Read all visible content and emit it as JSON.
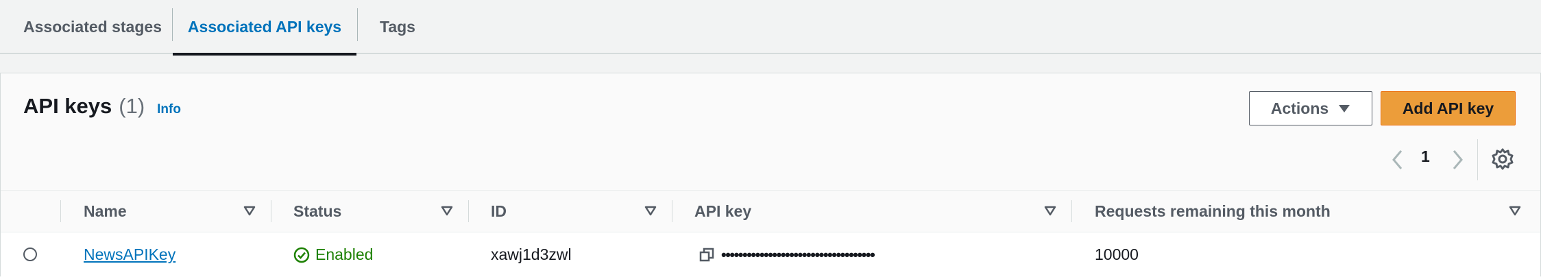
{
  "tabs": [
    {
      "label": "Associated stages",
      "active": false
    },
    {
      "label": "Associated API keys",
      "active": true
    },
    {
      "label": "Tags",
      "active": false
    }
  ],
  "panel": {
    "title": "API keys",
    "count": "(1)",
    "info_label": "Info",
    "actions_label": "Actions",
    "add_label": "Add API key"
  },
  "pagination": {
    "current_page": "1"
  },
  "table": {
    "columns": [
      "Name",
      "Status",
      "ID",
      "API key",
      "Requests remaining this month"
    ],
    "rows": [
      {
        "name": "NewsAPIKey",
        "status": "Enabled",
        "id": "xawj1d3zwl",
        "api_key": "••••••••••••••••••••••••••••••••••••",
        "requests_remaining": "10000"
      }
    ]
  },
  "colors": {
    "link": "#0073bb",
    "primary_button": "#ec9d3a",
    "status_enabled": "#1d8102"
  },
  "icons": {
    "actions_caret": "caret-down-icon",
    "prev": "chevron-left-icon",
    "next": "chevron-right-icon",
    "settings": "gear-icon",
    "sort": "sort-down-icon",
    "status": "check-circle-icon",
    "copy": "copy-icon"
  }
}
